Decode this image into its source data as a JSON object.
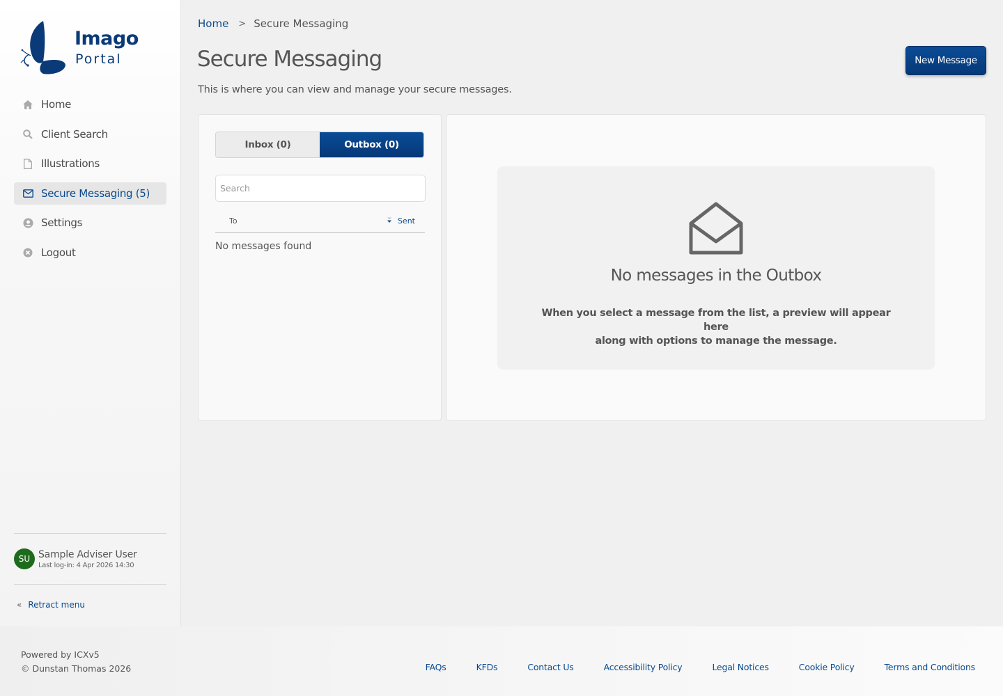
{
  "logo": {
    "line1": "Imago",
    "line2": "Portal"
  },
  "nav": {
    "items": [
      {
        "label": "Home",
        "icon": "home-icon"
      },
      {
        "label": "Client Search",
        "icon": "search-icon"
      },
      {
        "label": "Illustrations",
        "icon": "document-icon"
      },
      {
        "label": "Secure Messaging (5)",
        "icon": "envelope-icon",
        "active": true
      },
      {
        "label": "Settings",
        "icon": "user-circle-icon"
      },
      {
        "label": "Logout",
        "icon": "close-circle-icon"
      }
    ]
  },
  "user": {
    "initials": "SU",
    "name": "Sample Adviser User",
    "last_login": "Last log-in: 4 Apr 2026 14:30"
  },
  "retract": {
    "label": "Retract menu"
  },
  "breadcrumb": {
    "home": "Home",
    "separator": ">",
    "current": "Secure Messaging"
  },
  "page": {
    "title": "Secure Messaging",
    "description": "This is where you can view and manage your secure messages.",
    "new_message_label": "New Message"
  },
  "tabs": {
    "inbox": "Inbox (0)",
    "outbox": "Outbox (0)",
    "active": "outbox"
  },
  "search": {
    "placeholder": "Search"
  },
  "columns": {
    "to": "To",
    "sent": "Sent"
  },
  "list": {
    "empty_text": "No messages found"
  },
  "preview": {
    "title": "No messages in the Outbox",
    "line1": "When you select a message from the list, a preview will appear here",
    "line2": "along with options to manage the message."
  },
  "footer": {
    "powered_by": "Powered by ICXv5",
    "copyright": "© Dunstan Thomas 2026",
    "links": [
      "FAQs",
      "KFDs",
      "Contact Us",
      "Accessibility Policy",
      "Legal Notices",
      "Cookie Policy",
      "Terms and Conditions"
    ]
  },
  "colors": {
    "brand": "#0a4a8f",
    "button": "#063878",
    "avatar": "#1e6b1e"
  }
}
